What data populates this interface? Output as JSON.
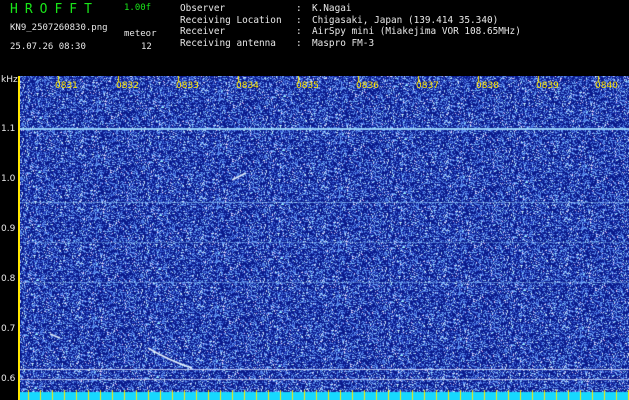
{
  "header": {
    "app_name": "HROFFT",
    "version": "1.00f",
    "filename": "KN9_2507260830.png",
    "datetime": "25.07.26 08:30",
    "meteor_label": "meteor",
    "meteor_count": "12",
    "fields": [
      {
        "key": "Observer",
        "value": "K.Nagai"
      },
      {
        "key": "Receiving Location",
        "value": "Chigasaki, Japan (139.414 35.340)"
      },
      {
        "key": "Receiver",
        "value": "AirSpy mini (Miakejima VOR 108.65MHz)"
      },
      {
        "key": "Receiving antenna",
        "value": "Maspro FM-3"
      }
    ]
  },
  "axis": {
    "unit": "kHz",
    "y_labels": [
      "1.1",
      "1.0",
      "0.9",
      "0.8",
      "0.7",
      "0.6"
    ],
    "time_labels": [
      "0831",
      "0832",
      "0833",
      "0834",
      "0835",
      "0836",
      "0837",
      "0838",
      "0839",
      "0840"
    ]
  },
  "colors": {
    "background": "#000000",
    "waterfall_bg": "#0a1a8c",
    "noise": "#5a7dff",
    "signal": "#9fdcff",
    "header_title": "#19e619",
    "tick_yellow": "#ffe600",
    "bottom_band": "#17d8ff"
  }
}
